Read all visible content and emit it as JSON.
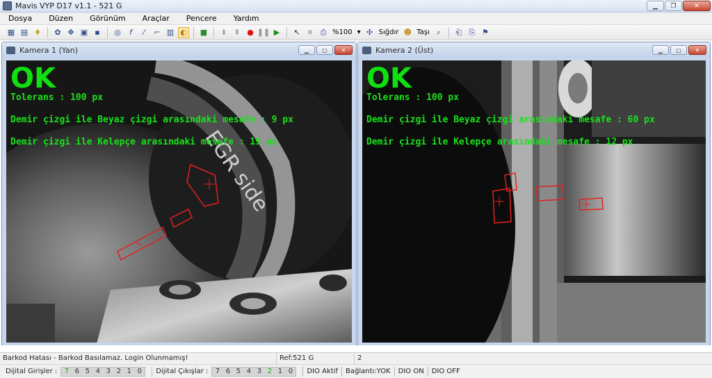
{
  "window": {
    "title": "Mavis VYP D17 v1.1 - 521 G"
  },
  "menu": [
    "Dosya",
    "Düzen",
    "Görünüm",
    "Araçlar",
    "Pencere",
    "Yardım"
  ],
  "toolbar": {
    "zoom": "%100",
    "fit": "Sığdır",
    "move": "Taşı"
  },
  "cameras": [
    {
      "title": "Kamera 1 (Yan)",
      "result": "OK",
      "tolerance": "Tolerans : 100 px",
      "line1": "Demir çizgi ile Beyaz çizgi arasındaki mesafe : 9 px",
      "line2": "Demir çizgi ile Kelepçe arasındaki mesafe : 19 px",
      "part_text": "EGR side"
    },
    {
      "title": "Kamera 2 (Üst)",
      "result": "OK",
      "tolerance": "Tolerans : 100 px",
      "line1": "Demir çizgi ile Beyaz çizgi arasındaki mesafe : 60 px",
      "line2": "Demir çizgi ile Kelepçe arasındaki mesafe : 12 px"
    }
  ],
  "status": {
    "message": "Barkod Hatası - Barkod Basılamaz. Login Olunmamış!",
    "ref": "Ref:521 G",
    "count": "2"
  },
  "io": {
    "inputs_label": "Dijital Girişler :",
    "inputs": [
      "7",
      "6",
      "5",
      "4",
      "3",
      "2",
      "1",
      "0"
    ],
    "outputs_label": "Dijital Çıkışlar :",
    "outputs": [
      "7",
      "6",
      "5",
      "4",
      "3",
      "2",
      "1",
      "0"
    ],
    "dio_active": "DIO Aktif",
    "connection": "Bağlantı:YOK",
    "dio_on": "DIO ON",
    "dio_off": "DIO OFF"
  }
}
